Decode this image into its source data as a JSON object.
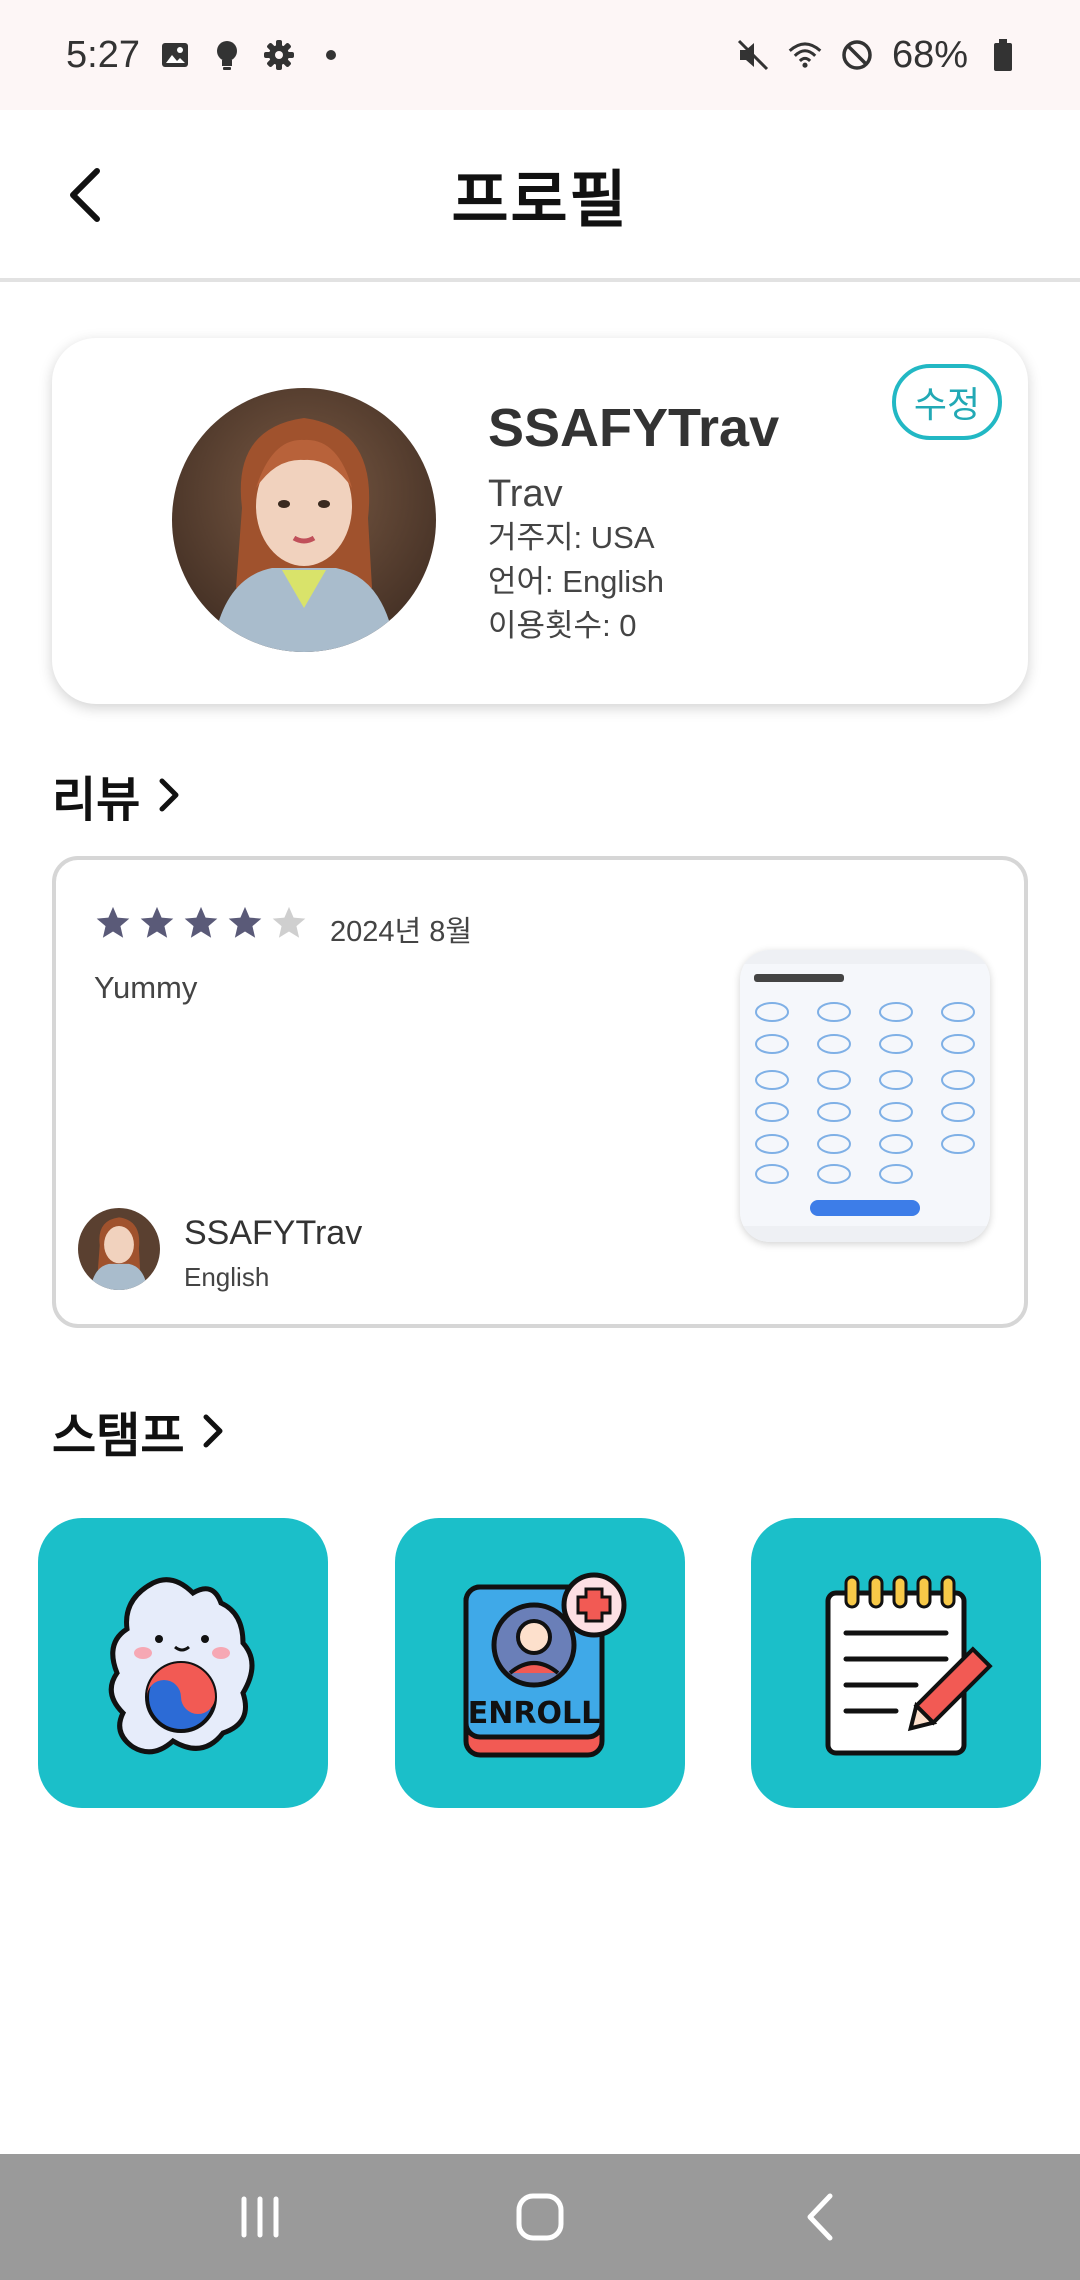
{
  "status_bar": {
    "time": "5:27",
    "battery": "68%",
    "left_icons": [
      "image-icon",
      "bulb-icon",
      "gear-icon",
      "dot-icon"
    ],
    "right_icons": [
      "mute-icon",
      "wifi-icon",
      "do-not-disturb-icon",
      "battery-icon"
    ]
  },
  "header": {
    "title": "프로필"
  },
  "profile": {
    "name": "SSAFYTrav",
    "nickname": "Trav",
    "residence": "거주지: USA",
    "language": "언어: English",
    "usage_count": "이용횟수: 0",
    "edit_label": "수정"
  },
  "reviews_section": {
    "title": "리뷰"
  },
  "review": {
    "rating": 4,
    "max_rating": 5,
    "date": "2024년 8월",
    "text": "Yummy",
    "reviewer_name": "SSAFYTrav",
    "reviewer_language": "English"
  },
  "stamps_section": {
    "title": "스탬프",
    "stamps": [
      {
        "icon": "korea-map-icon"
      },
      {
        "icon": "enroll-icon",
        "label": "ENROLL"
      },
      {
        "icon": "notepad-pencil-icon"
      }
    ]
  },
  "colors": {
    "accent": "#1bbfc9",
    "star_filled": "#5a5a78",
    "star_empty": "#cfcfcf",
    "nav_bar": "#9a9a9a"
  }
}
